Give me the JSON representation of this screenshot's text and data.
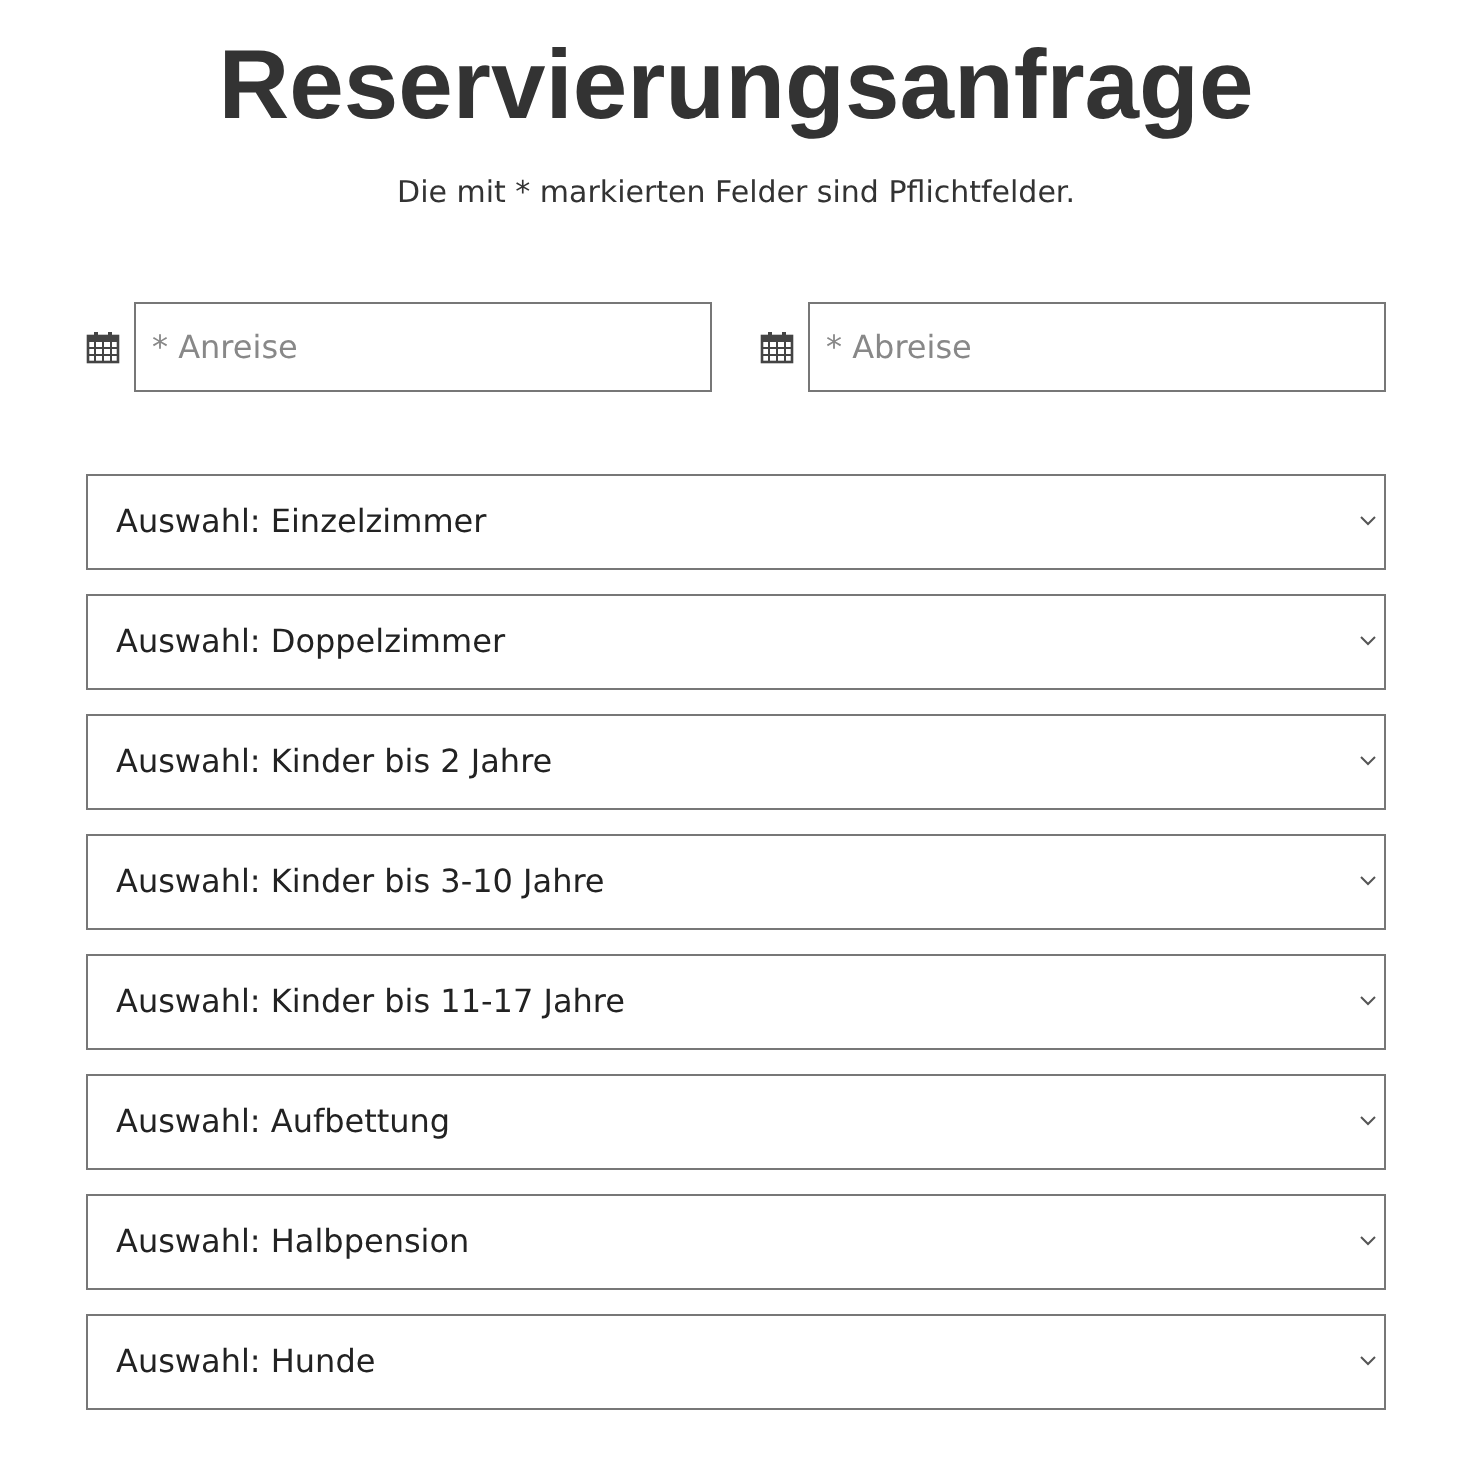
{
  "title": "Reservierungsanfrage",
  "subtitle": "Die mit * markierten Felder sind Pflichtfelder.",
  "date_fields": [
    {
      "placeholder": "* Anreise"
    },
    {
      "placeholder": "* Abreise"
    }
  ],
  "selects": [
    {
      "value": "Auswahl: Einzelzimmer"
    },
    {
      "value": "Auswahl: Doppelzimmer"
    },
    {
      "value": "Auswahl: Kinder bis 2 Jahre"
    },
    {
      "value": "Auswahl: Kinder bis 3-10 Jahre"
    },
    {
      "value": "Auswahl: Kinder bis 11-17 Jahre"
    },
    {
      "value": "Auswahl: Aufbettung"
    },
    {
      "value": "Auswahl: Halbpension"
    },
    {
      "value": "Auswahl: Hunde"
    }
  ]
}
